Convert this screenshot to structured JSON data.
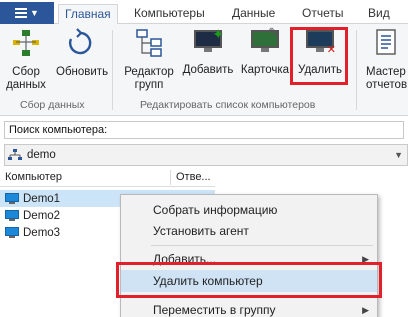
{
  "tabs": [
    "Главная",
    "Компьютеры",
    "Данные",
    "Отчеты",
    "Вид"
  ],
  "active_tab": "Главная",
  "ribbon": {
    "collect_label": "Сбор\nданных",
    "collect_l1": "Сбор",
    "collect_l2": "данных",
    "refresh": "Обновить",
    "group_editor_l1": "Редактор",
    "group_editor_l2": "групп",
    "add": "Добавить",
    "card": "Карточка",
    "delete": "Удалить",
    "master_l1": "Мастер",
    "master_l2": "отчетов",
    "group1_label": "Сбор данных",
    "group2_label": "Редактировать список компьютеров"
  },
  "search": {
    "label": "Поиск компьютера:"
  },
  "group_select": {
    "value": "demo"
  },
  "table": {
    "headers": [
      "Компьютер",
      "Отве..."
    ],
    "rows": [
      "Demo1",
      "Demo2",
      "Demo3"
    ]
  },
  "context_menu": {
    "items": [
      "Собрать информацию",
      "Установить агент",
      "Добавить...",
      "Удалить компьютер",
      "Переместить в группу"
    ]
  },
  "colors": {
    "accent": "#2b579a",
    "highlight": "#e0202a",
    "selection": "#cce4f7"
  }
}
